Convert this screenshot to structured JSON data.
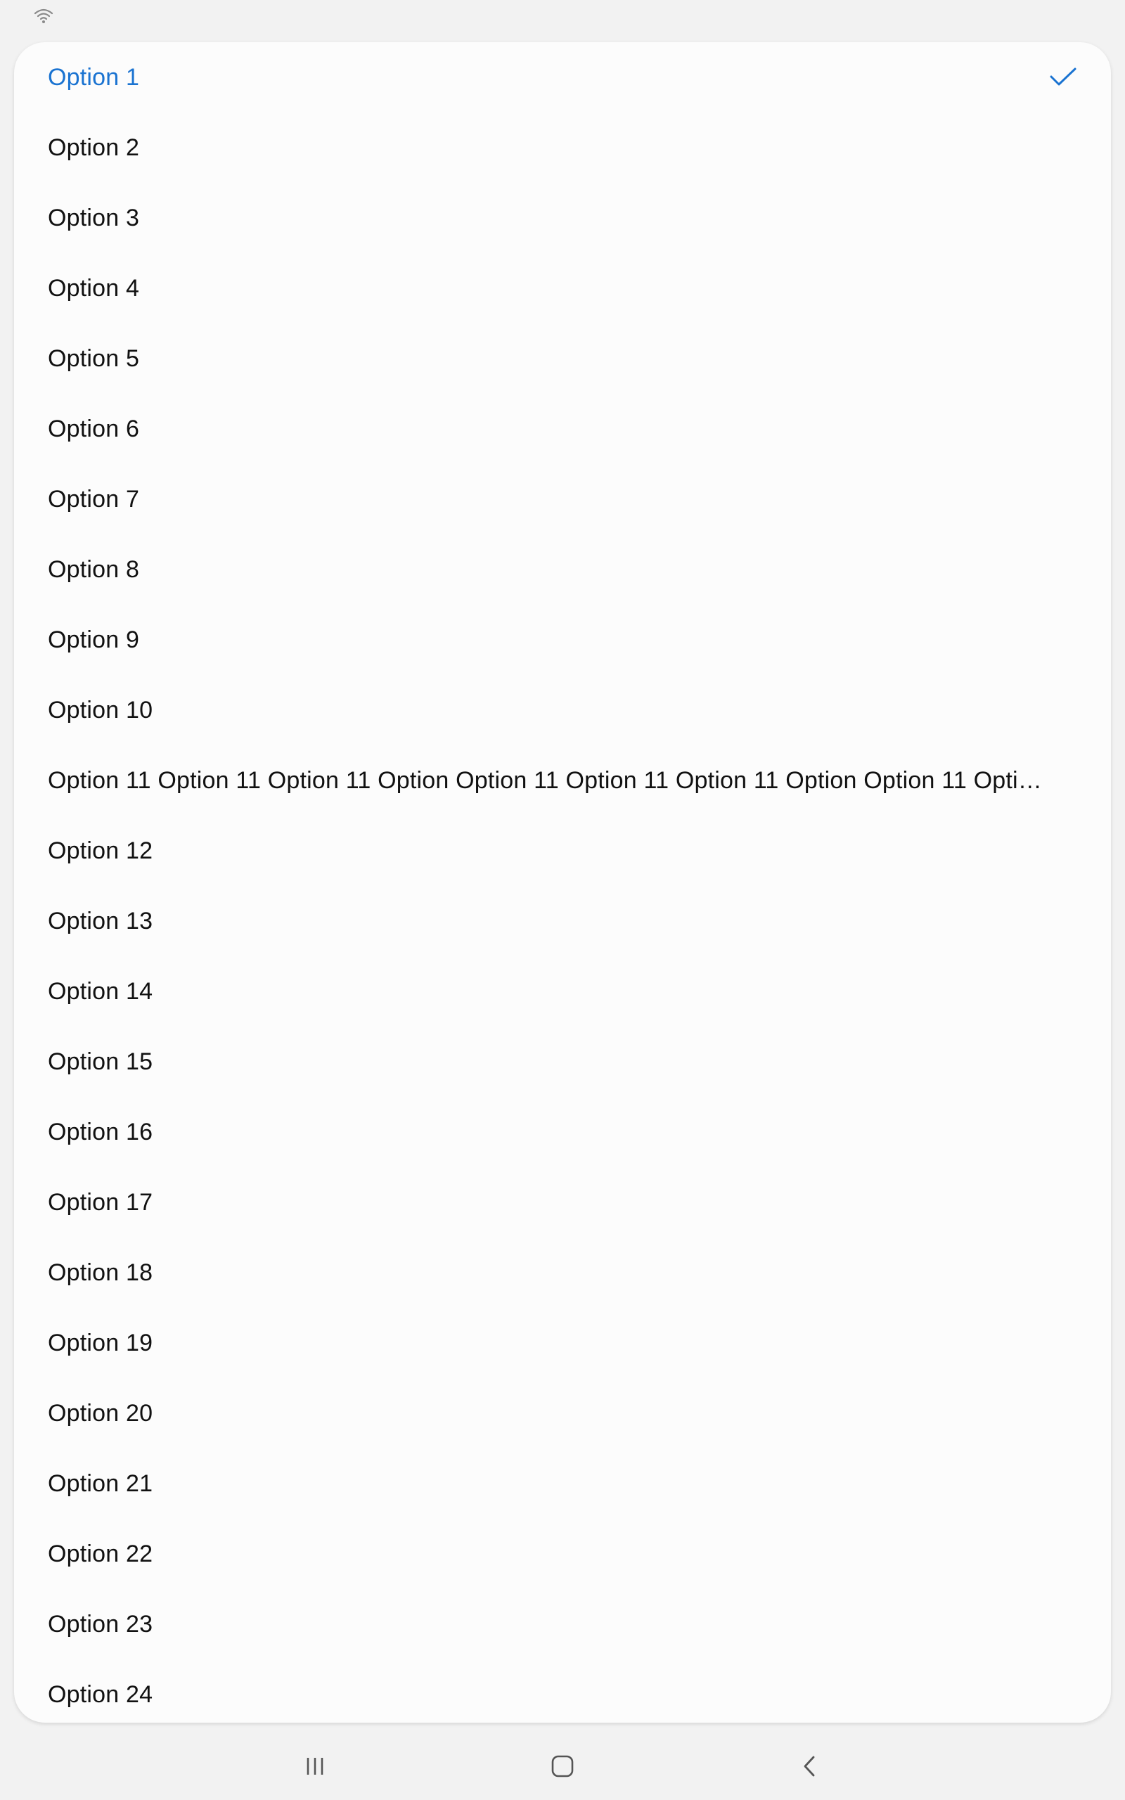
{
  "status_bar": {
    "icons": [
      "wifi-icon"
    ]
  },
  "dropdown": {
    "selected_index": 0,
    "accent_color": "#1a73d1",
    "options": [
      {
        "label": "Option 1",
        "selected": true
      },
      {
        "label": "Option 2",
        "selected": false
      },
      {
        "label": "Option 3",
        "selected": false
      },
      {
        "label": "Option 4",
        "selected": false
      },
      {
        "label": "Option 5",
        "selected": false
      },
      {
        "label": "Option 6",
        "selected": false
      },
      {
        "label": "Option 7",
        "selected": false
      },
      {
        "label": "Option 8",
        "selected": false
      },
      {
        "label": "Option 9",
        "selected": false
      },
      {
        "label": "Option 10",
        "selected": false
      },
      {
        "label": "Option 11 Option 11 Option 11 Option Option 11 Option 11 Option 11 Option Option 11 Option ...",
        "selected": false
      },
      {
        "label": "Option 12",
        "selected": false
      },
      {
        "label": "Option 13",
        "selected": false
      },
      {
        "label": "Option 14",
        "selected": false
      },
      {
        "label": "Option 15",
        "selected": false
      },
      {
        "label": "Option 16",
        "selected": false
      },
      {
        "label": "Option 17",
        "selected": false
      },
      {
        "label": "Option 18",
        "selected": false
      },
      {
        "label": "Option 19",
        "selected": false
      },
      {
        "label": "Option 20",
        "selected": false
      },
      {
        "label": "Option 21",
        "selected": false
      },
      {
        "label": "Option 22",
        "selected": false
      },
      {
        "label": "Option 23",
        "selected": false
      },
      {
        "label": "Option 24",
        "selected": false
      }
    ]
  },
  "nav_bar": {
    "buttons": [
      "recents-icon",
      "home-icon",
      "back-icon"
    ]
  }
}
